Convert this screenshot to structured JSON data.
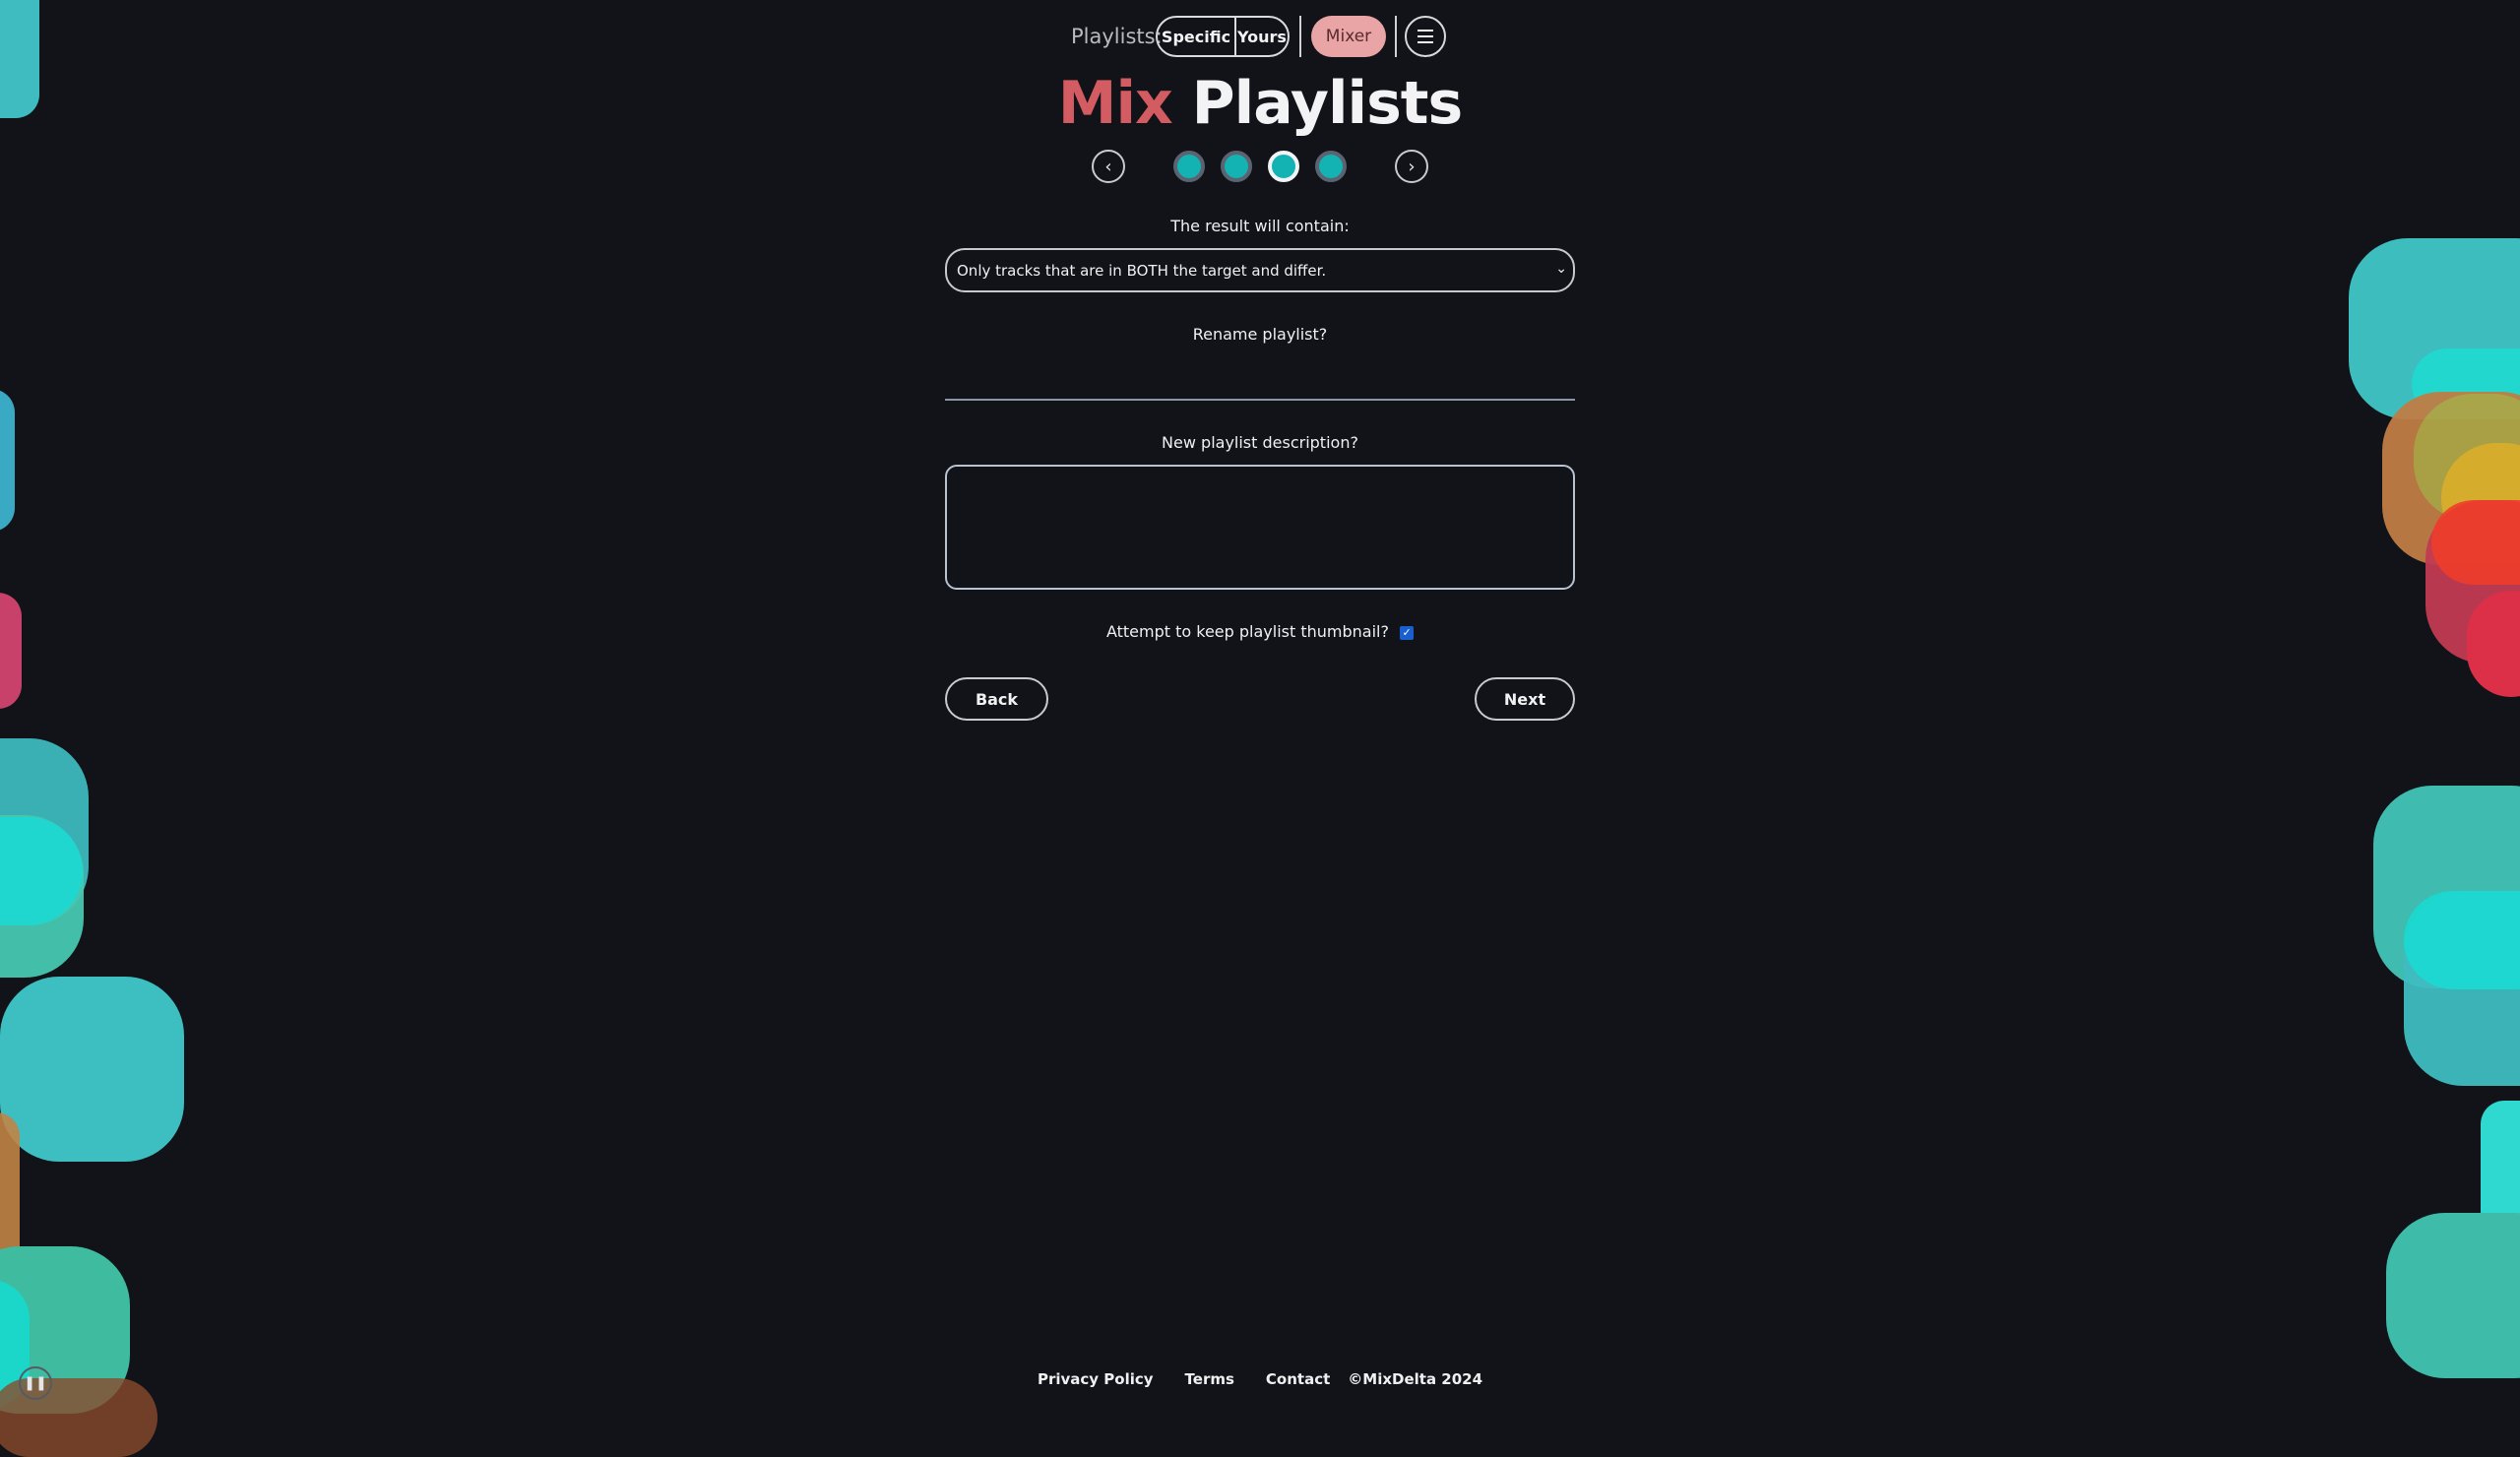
{
  "nav": {
    "playlists_label": "Playlists:",
    "specific_label": "Specific",
    "yours_label": "Yours",
    "mixer_label": "Mixer",
    "menu_icon": "hamburger-menu-icon"
  },
  "header": {
    "title_accent": "Mix",
    "title_rest": "Playlists"
  },
  "stepper": {
    "steps": 4,
    "active_step": 3,
    "prev_icon": "chevron-left-icon",
    "next_icon": "chevron-right-icon"
  },
  "form": {
    "result_label": "The result will contain:",
    "result_value": "Only tracks that are in BOTH the target and differ.",
    "rename_label": "Rename playlist?",
    "rename_value": "",
    "description_label": "New playlist description?",
    "description_value": "",
    "thumbnail_label": "Attempt to keep playlist thumbnail?",
    "thumbnail_checked": true
  },
  "actions": {
    "back_label": "Back",
    "next_label": "Next"
  },
  "footer": {
    "privacy": "Privacy Policy",
    "terms": "Terms",
    "contact": "Contact",
    "copyright": "©MixDelta 2024"
  },
  "colors": {
    "accent": "#d25c62",
    "mixer_bg": "#e9a5a5",
    "teal": "#13b3b3",
    "background": "#121318"
  }
}
